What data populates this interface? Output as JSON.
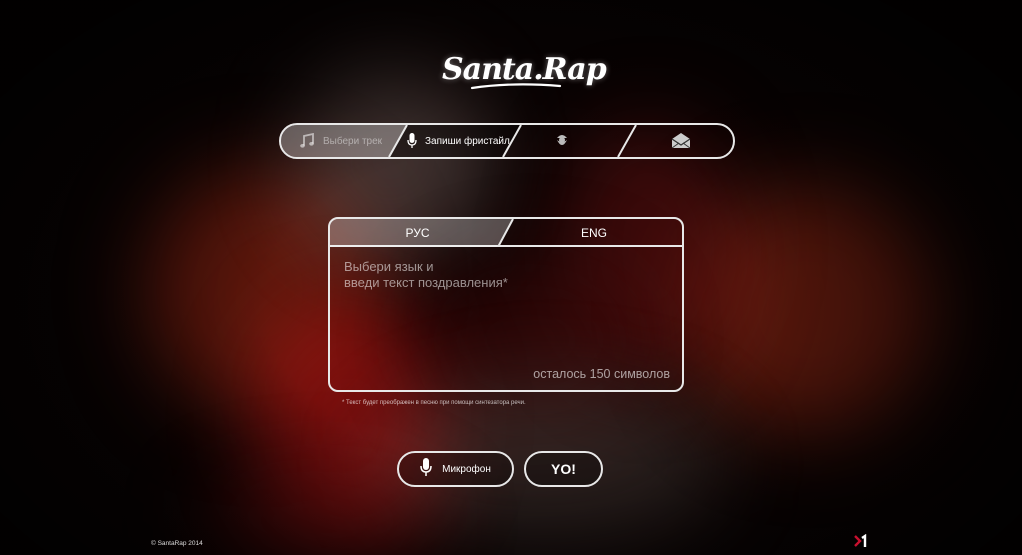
{
  "logo": {
    "text": "Santa.Rap"
  },
  "steps": [
    {
      "label": "Выбери трек",
      "icon": "music-note-icon",
      "state": "done"
    },
    {
      "label": "Запиши фристайл",
      "icon": "microphone-icon",
      "state": "active"
    },
    {
      "label": "",
      "icon": "santa-icon",
      "state": "pending"
    },
    {
      "label": "",
      "icon": "envelope-icon",
      "state": "pending"
    }
  ],
  "lang_tabs": [
    {
      "label": "РУС",
      "selected": true
    },
    {
      "label": "ENG",
      "selected": false
    }
  ],
  "message": {
    "value": "",
    "placeholder": "Выбери язык и\nвведи текст поздравления*",
    "remaining": "осталось 150 символов"
  },
  "footnote": "* Текст будет преображен в песню при помощи синтезатора речи.",
  "buttons": {
    "microphone": "Микрофон",
    "yo": "YO!"
  },
  "footer": {
    "copyright": "© SantaRap 2014"
  },
  "colors": {
    "border": "#e8e8e8",
    "background": "#0a0303",
    "accent_red": "#c8102e"
  }
}
